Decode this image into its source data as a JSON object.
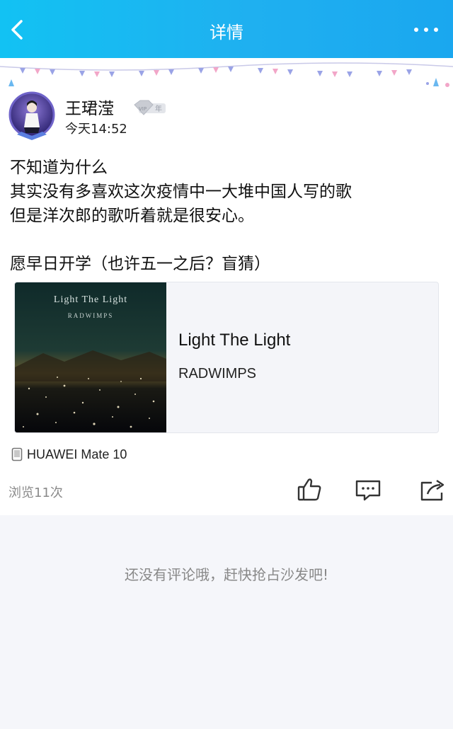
{
  "header": {
    "title": "详情",
    "back_icon": "chevron-left-icon",
    "more_icon": "more-horizontal-icon"
  },
  "post": {
    "author": "王珺滢",
    "vip_badge": "年",
    "time": "今天14:52",
    "lines": [
      "不知道为什么",
      "其实没有多喜欢这次疫情中一大堆中国人写的歌",
      "但是洋次郎的歌听着就是很安心。",
      "",
      "愿早日开学（也许五一之后？盲猜）"
    ],
    "music": {
      "title": "Light The Light",
      "artist": "RADWIMPS",
      "cover_title": "Light  The  Light",
      "cover_artist": "RADWIMPS"
    },
    "device": "HUAWEI Mate 10",
    "views": "浏览11次"
  },
  "comments": {
    "empty_text": "还没有评论哦，赶快抢占沙发吧!"
  },
  "colors": {
    "header_top": "#12c2f3",
    "header_accent": "#1aa7ef",
    "background": "#f5f6fa",
    "muted_text": "#888888"
  }
}
